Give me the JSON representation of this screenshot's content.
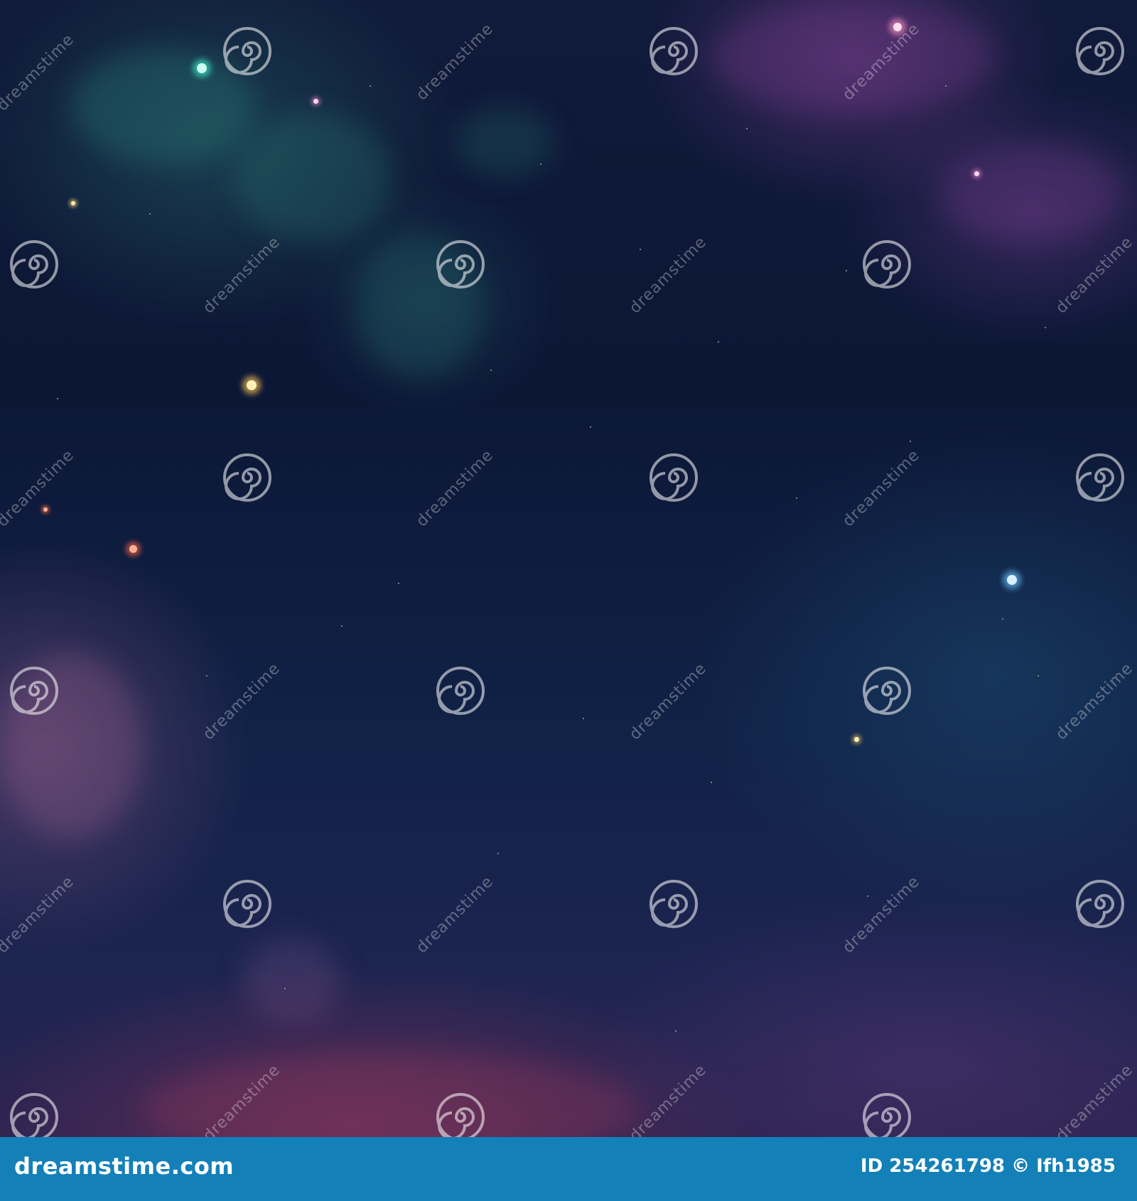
{
  "watermark": {
    "text": "dreamstime",
    "icon": "spiral-logo-icon"
  },
  "footer": {
    "logo_text": "dreamstime.com",
    "image_id": "ID 254261798",
    "copyright": "© Ifh1985",
    "background_color": "#1380b8"
  },
  "colors": {
    "sky_top": "#101a3a",
    "sky_bottom": "#2b2350",
    "nebula_teal": "#286e6e",
    "nebula_purple": "#783c8c",
    "nebula_pink": "#8c375f"
  }
}
